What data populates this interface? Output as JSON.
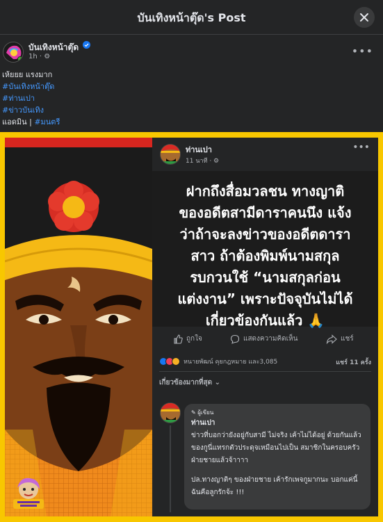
{
  "header": {
    "title": "บันเทิงหน้าตุ๊ด's Post"
  },
  "post": {
    "author": "บันเทิงหน้าตุ๊ด",
    "time": "1h · ⚙",
    "caption_line1": "เห้ยยย แรงมาก",
    "tags": [
      "#บันเทิงหน้าตุ๊ด",
      "#ท่านเปา",
      "#ข่าวบันเทิง"
    ],
    "admin_label": "แอดมิน | ",
    "admin_tag": "#มนตรี"
  },
  "inner_post": {
    "author": "ท่านเปา",
    "time": "11 นาที · ⚙",
    "body_lines": [
      "ฝากถึงสื่อมวลชน ทางญาติ",
      "ของอดีตสามีดาราคนนึง แจ้ง",
      "ว่าถ้าจะลงข่าวของอดีตดารา",
      "สาว ถ้าต้องพิมพ์นามสกุล",
      "รบกวนใช้ “นามสกุลก่อน",
      "แต่งงาน” เพราะปัจจุบันไม่ได้",
      "เกี่ยวข้องกันแล้ว 🙏"
    ],
    "actions": {
      "like": "ถูกใจ",
      "comment": "แสดงความคิดเห็น",
      "share": "แชร์"
    },
    "reactions_text": "หนายพัฒน์ คุยกฎหมาย และ3,085",
    "shares_text": "แชร์ 11 ครั้ง",
    "sort_label": "เกี่ยวข้องมากที่สุด ⌄",
    "comment": {
      "role": "✎ ผู้เขียน",
      "name": "ท่านเปา",
      "para1": "ข่าวที่บอกว่ายังอยู่กับสามี ไม่จริง เค้าไม่ได้อยู่ ด้วยกันแล้ว ของกูนี่แทรกตัวประดุจเหมือนไปเป็น สมาชิกในครอบครัวฝ่ายชายแล้วจ้าาาา",
      "para2": "ปล.ทางญาติๆ ของฝ่ายชาย เค้ารักเพจกูมากนะ บอกแค่นี้ ฉันคือลูกรักจ้ะ !!!"
    }
  },
  "colors": {
    "background": "#242526",
    "frame_yellow": "#f8c700",
    "link_blue": "#4599ff"
  }
}
